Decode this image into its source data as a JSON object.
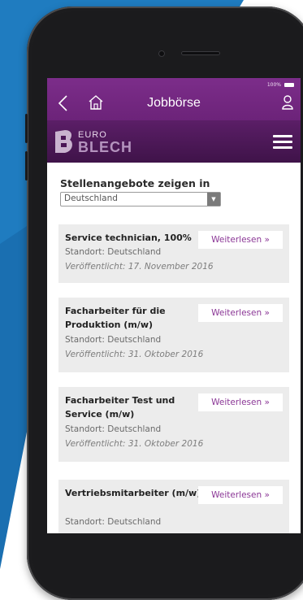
{
  "header": {
    "title": "Jobbörse",
    "battery": "100%"
  },
  "logo": {
    "line1": "EURO",
    "line2": "BLECH"
  },
  "filter": {
    "label": "Stellenangebote zeigen in",
    "selected": "Deutschland"
  },
  "jobs": [
    {
      "title": "Service technician, 100%",
      "location": "Standort: Deutschland",
      "published": "Veröffentlicht: 17. November 2016",
      "button": "Weiterlesen »"
    },
    {
      "title": "Facharbeiter für die Produktion (m/w)",
      "location": "Standort: Deutschland",
      "published": "Veröffentlicht: 31. Oktober 2016",
      "button": "Weiterlesen »"
    },
    {
      "title": "Facharbeiter Test und Service (m/w)",
      "location": "Standort: Deutschland",
      "published": "Veröffentlicht: 31. Oktober 2016",
      "button": "Weiterlesen »"
    },
    {
      "title": "Vertriebsmitarbeiter (m/w)",
      "location": "Standort: Deutschland",
      "published": "",
      "button": "Weiterlesen »"
    }
  ],
  "colors": {
    "brand_purple": "#7c2d8a",
    "logo_bar": "#4a1656",
    "link_purple": "#8b3796",
    "background_blue": "#1f7cc0",
    "card_gray": "#ececec"
  },
  "icons": [
    "back-icon",
    "home-icon",
    "user-icon",
    "menu-icon",
    "logo-mark-icon",
    "dropdown-arrow-icon"
  ]
}
